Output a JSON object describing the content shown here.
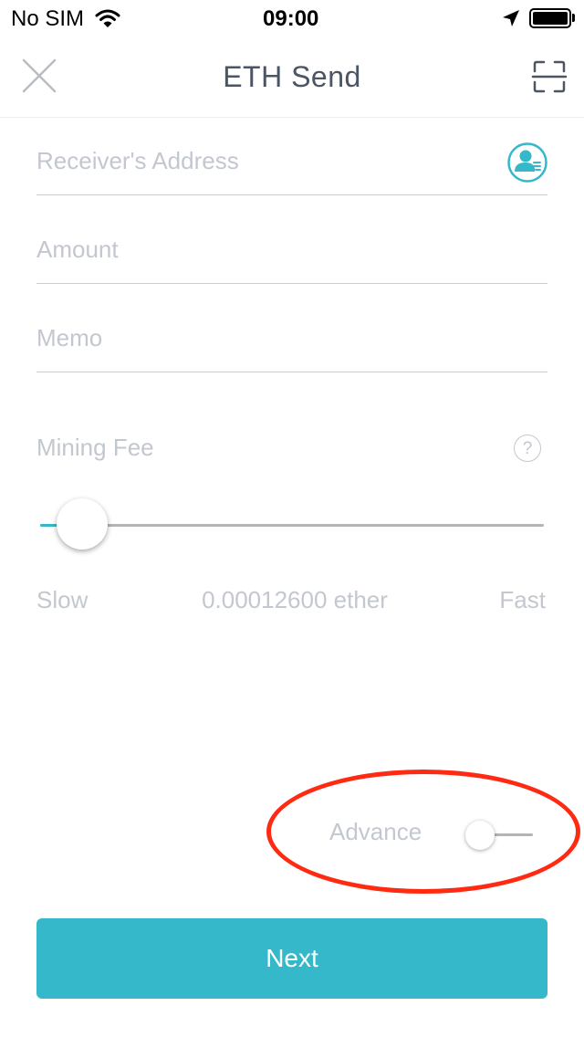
{
  "status_bar": {
    "carrier": "No SIM",
    "time": "09:00"
  },
  "nav": {
    "title": "ETH Send",
    "close_icon": "close-icon",
    "scan_icon": "scan-icon"
  },
  "form": {
    "receiver_placeholder": "Receiver's Address",
    "amount_placeholder": "Amount",
    "memo_placeholder": "Memo",
    "contacts_icon": "contacts-icon"
  },
  "mining_fee": {
    "label": "Mining Fee",
    "help_icon_glyph": "?",
    "slider_level": 0.05,
    "slow_label": "Slow",
    "value_text": "0.00012600 ether",
    "fast_label": "Fast"
  },
  "advance": {
    "label": "Advance",
    "enabled": false
  },
  "actions": {
    "next_label": "Next"
  },
  "colors": {
    "accent": "#35b8c9",
    "annotation": "#ff2a12",
    "placeholder": "#c3c7cf",
    "title": "#4b5563"
  }
}
